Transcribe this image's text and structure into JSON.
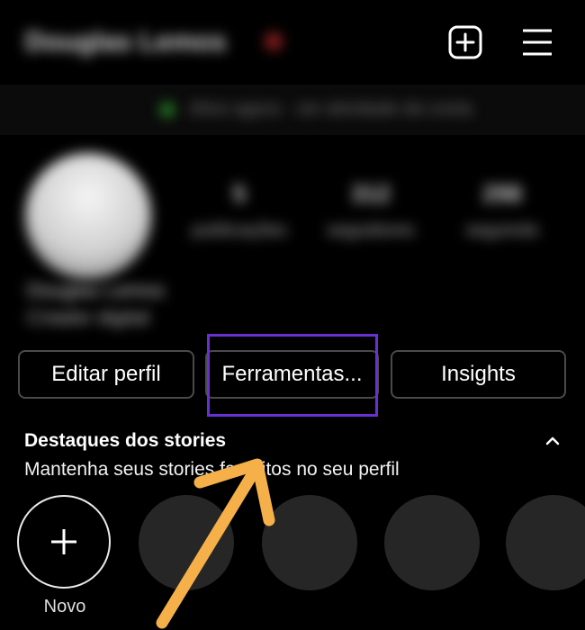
{
  "header": {
    "username": "Douglas Lemos",
    "new_post_icon": "plus-square-icon",
    "menu_icon": "hamburger-menu-icon"
  },
  "banner": {
    "text": "Ativo agora · ver atividade da conta"
  },
  "profile": {
    "stats": [
      {
        "value": "5",
        "label": "publicações"
      },
      {
        "value": "312",
        "label": "seguidores"
      },
      {
        "value": "298",
        "label": "seguindo"
      }
    ],
    "bio_name": "Douglas Lemos",
    "bio_line": "Criador digital"
  },
  "buttons": {
    "edit": "Editar perfil",
    "tools": "Ferramentas...",
    "insights": "Insights"
  },
  "stories": {
    "title": "Destaques dos stories",
    "subtitle": "Mantenha seus stories favoritos no seu perfil",
    "new_label": "Novo",
    "collapse_icon": "chevron-up-icon"
  },
  "colors": {
    "background": "#000000",
    "highlight_box": "#6a2fd0",
    "arrow": "#f5b04a",
    "highlight_placeholder": "#262626"
  }
}
